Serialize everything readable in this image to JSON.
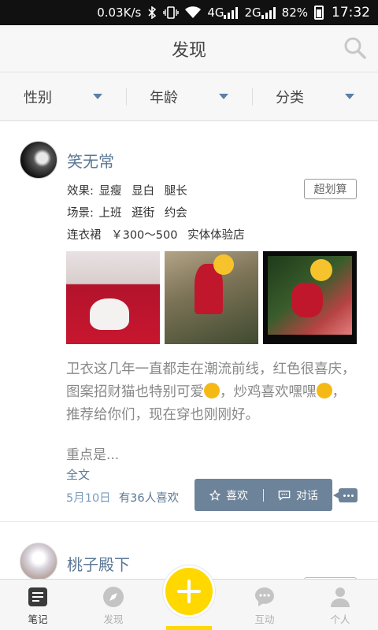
{
  "status_bar": {
    "speed": "0.03K/s",
    "network_4g": "4G",
    "network_2g": "2G",
    "battery": "82%",
    "time": "17:32"
  },
  "header": {
    "title": "发现"
  },
  "filters": [
    {
      "label": "性别"
    },
    {
      "label": "年龄"
    },
    {
      "label": "分类"
    }
  ],
  "post": {
    "username": "笑无常",
    "badge": "超划算",
    "effect_label": "效果:",
    "effects": [
      "显瘦",
      "显白",
      "腿长"
    ],
    "scene_label": "场景:",
    "scenes": [
      "上班",
      "逛街",
      "约会"
    ],
    "product": "连衣裙",
    "price": "￥300～500",
    "store": "实体体验店",
    "text_part1": "卫衣这几年一直都走在潮流前线，红色很喜庆，图案招财猫也特别可爱",
    "text_part2": "，炒鸡喜欢嘿嘿",
    "text_part3": "，推荐给你们，现在穿也刚刚好。",
    "highlight": "重点是...",
    "fulltext": "全文",
    "date": "5月10日",
    "likes": "有36人喜欢",
    "like_label": "喜欢",
    "chat_label": "对话"
  },
  "post2": {
    "username": "桃子殿下"
  },
  "bottom_nav": [
    {
      "label": "笔记"
    },
    {
      "label": "发现"
    },
    {
      "label": ""
    },
    {
      "label": "互动"
    },
    {
      "label": "个人"
    }
  ],
  "colors": {
    "accent": "#ffd800",
    "link": "#5b7896",
    "action_bar": "#6d8399"
  }
}
